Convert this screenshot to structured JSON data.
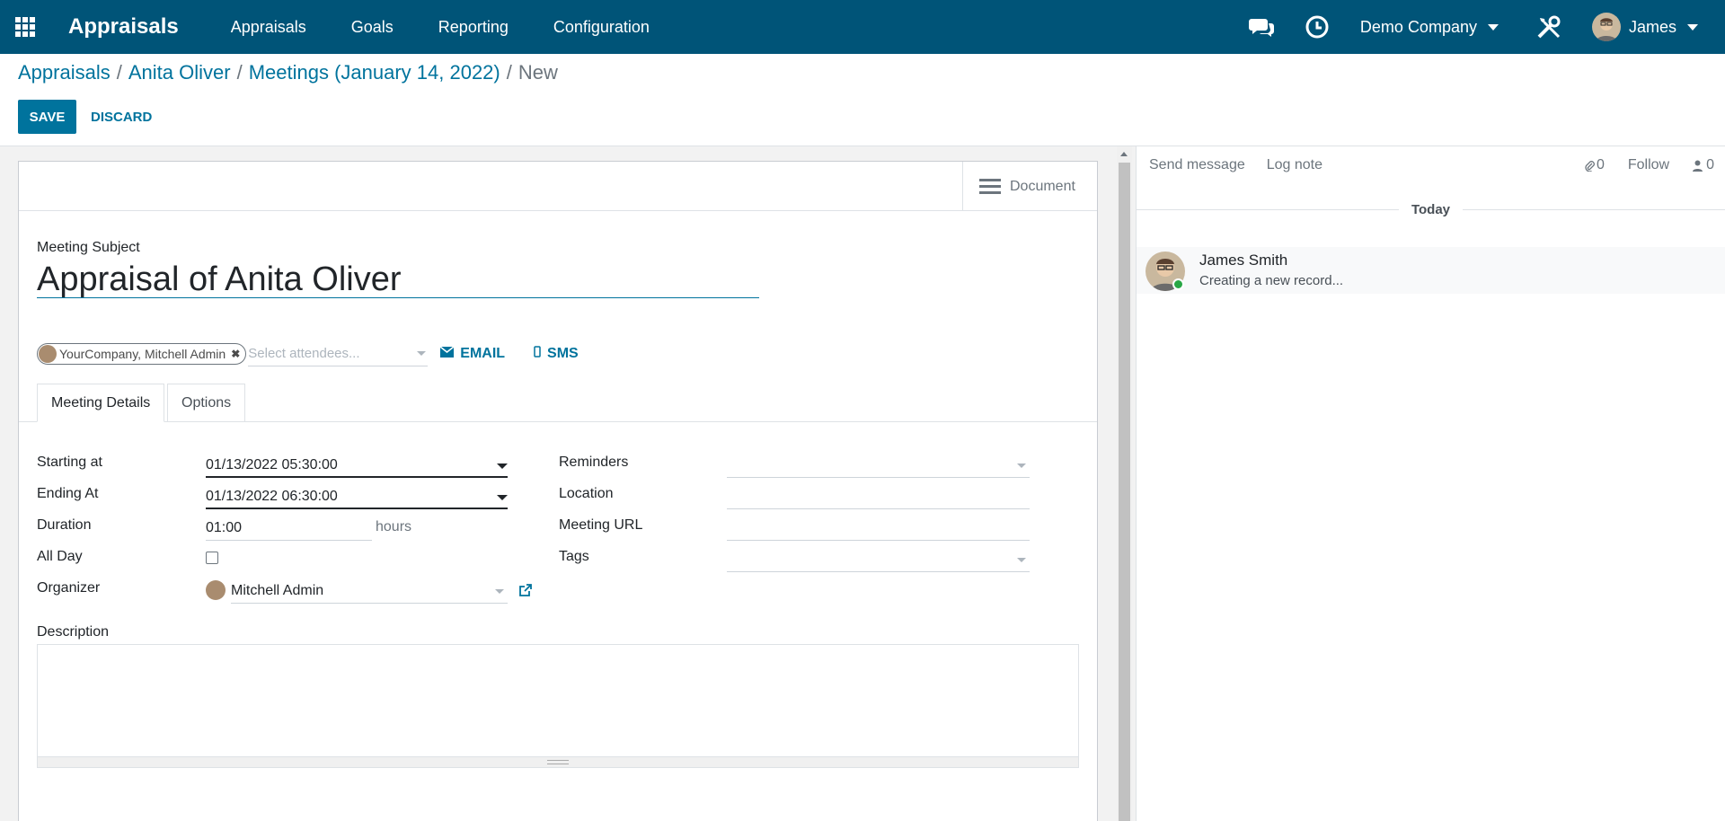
{
  "navbar": {
    "brand": "Appraisals",
    "menu": [
      "Appraisals",
      "Goals",
      "Reporting",
      "Configuration"
    ],
    "company": "Demo Company",
    "user": "James"
  },
  "breadcrumb": {
    "items": [
      "Appraisals",
      "Anita Oliver",
      "Meetings (January 14, 2022)"
    ],
    "current": "New",
    "separator": "/"
  },
  "actions": {
    "save": "SAVE",
    "discard": "DISCARD"
  },
  "statusbar": {
    "document_label": "Document"
  },
  "form": {
    "subject_label": "Meeting Subject",
    "subject_value": "Appraisal of Anita Oliver",
    "attendee_tag": "YourCompany, Mitchell Admin",
    "attendee_placeholder": "Select attendees...",
    "email_label": "EMAIL",
    "sms_label": "SMS",
    "tabs": [
      "Meeting Details",
      "Options"
    ],
    "left_fields": {
      "starting_at": {
        "label": "Starting at",
        "value": "01/13/2022 05:30:00"
      },
      "ending_at": {
        "label": "Ending At",
        "value": "01/13/2022 06:30:00"
      },
      "duration": {
        "label": "Duration",
        "value": "01:00",
        "unit": "hours"
      },
      "all_day": {
        "label": "All Day",
        "checked": false
      },
      "organizer": {
        "label": "Organizer",
        "value": "Mitchell Admin"
      }
    },
    "right_fields": {
      "reminders": {
        "label": "Reminders",
        "value": ""
      },
      "location": {
        "label": "Location",
        "value": ""
      },
      "meeting_url": {
        "label": "Meeting URL",
        "value": ""
      },
      "tags": {
        "label": "Tags",
        "value": ""
      }
    },
    "description_label": "Description"
  },
  "chatter": {
    "send_message": "Send message",
    "log_note": "Log note",
    "attachments_count": "0",
    "follow": "Follow",
    "followers_count": "0",
    "date_separator": "Today",
    "messages": [
      {
        "author": "James Smith",
        "body": "Creating a new record..."
      }
    ]
  },
  "colors": {
    "navbar": "#005478",
    "primary": "#00739d",
    "online": "#28a745"
  }
}
